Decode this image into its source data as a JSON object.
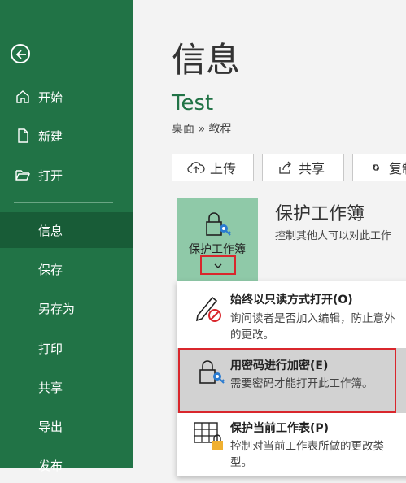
{
  "sidebar": {
    "items": [
      {
        "label": "开始",
        "icon": "home-icon"
      },
      {
        "label": "新建",
        "icon": "new-file-icon"
      },
      {
        "label": "打开",
        "icon": "open-folder-icon"
      }
    ],
    "sub_items": [
      "信息",
      "保存",
      "另存为",
      "打印",
      "共享",
      "导出",
      "发布"
    ],
    "active": "信息"
  },
  "main": {
    "title": "信息",
    "doc_name": "Test",
    "breadcrumb": "桌面 » 教程",
    "buttons": {
      "upload": "上传",
      "share": "共享",
      "copy": "复制"
    },
    "protect": {
      "tile_label": "保护工作簿",
      "title": "保护工作簿",
      "desc": "控制其他人可以对此工作"
    },
    "menu": [
      {
        "title": "始终以只读方式打开(O)",
        "desc": "询问读者是否加入编辑，防止意外的更改。"
      },
      {
        "title": "用密码进行加密(E)",
        "desc": "需要密码才能打开此工作簿。"
      },
      {
        "title": "保护当前工作表(P)",
        "desc": "控制对当前工作表所做的更改类型。"
      }
    ]
  },
  "colors": {
    "sidebar": "#217346",
    "sidebar_active": "#185c37",
    "accent": "#217346",
    "highlight": "#d9262c"
  }
}
